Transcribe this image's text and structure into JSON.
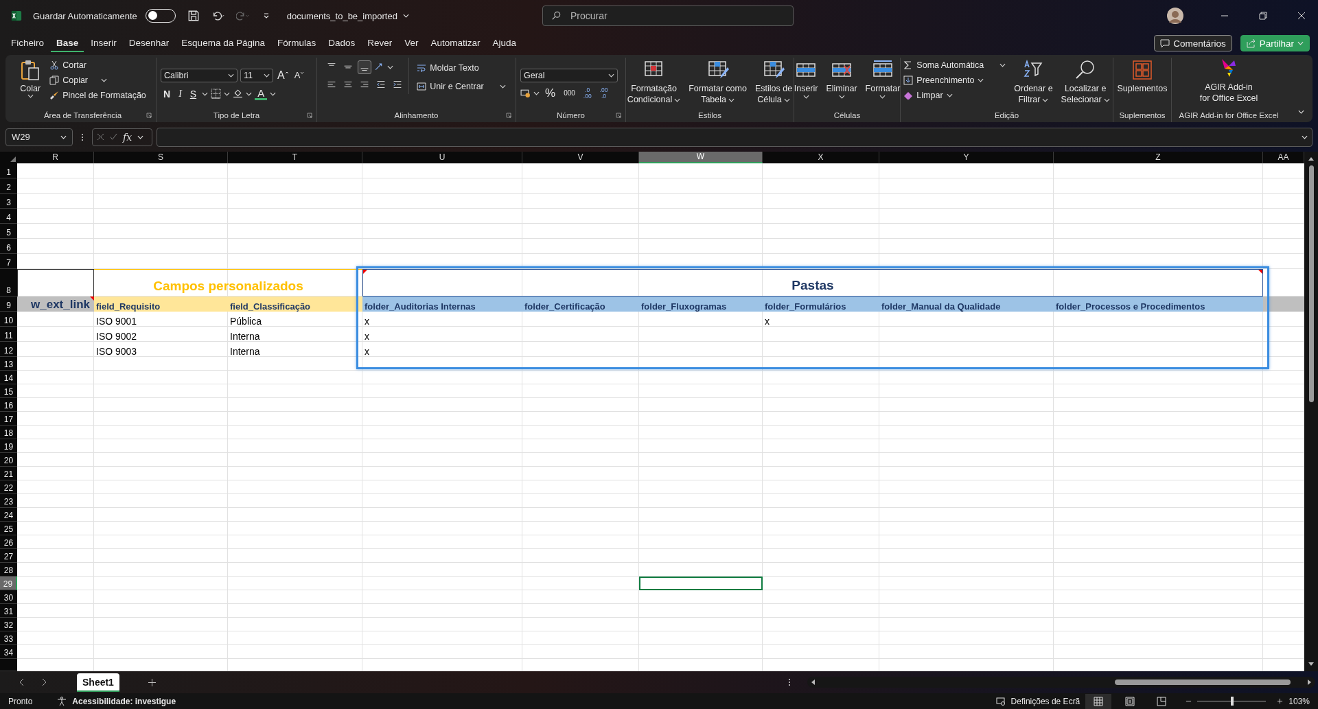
{
  "title_bar": {
    "autosave_label": "Guardar Automaticamente",
    "autosave_on": false,
    "redo_enabled": false,
    "file_name": "documents_to_be_imported",
    "search_placeholder": "Procurar"
  },
  "menu_tabs": [
    {
      "label": "Ficheiro",
      "selected": false
    },
    {
      "label": "Base",
      "selected": true
    },
    {
      "label": "Inserir",
      "selected": false
    },
    {
      "label": "Desenhar",
      "selected": false
    },
    {
      "label": "Esquema da Página",
      "selected": false
    },
    {
      "label": "Fórmulas",
      "selected": false
    },
    {
      "label": "Dados",
      "selected": false
    },
    {
      "label": "Rever",
      "selected": false
    },
    {
      "label": "Ver",
      "selected": false
    },
    {
      "label": "Automatizar",
      "selected": false
    },
    {
      "label": "Ajuda",
      "selected": false
    }
  ],
  "comments_button": "Comentários",
  "share_button": "Partilhar",
  "ribbon": {
    "clipboard": {
      "label": "Área de Transferência",
      "paste": "Colar",
      "cut": "Cortar",
      "copy": "Copiar",
      "format_painter": "Pincel de Formatação"
    },
    "font": {
      "label": "Tipo de Letra",
      "font_name": "Calibri",
      "font_size": "11",
      "grow": "A",
      "shrink": "A",
      "bold": "N",
      "italic": "I",
      "underline": "S",
      "font_color": "A"
    },
    "alignment": {
      "label": "Alinhamento",
      "valign": [
        {
          "selected": false
        },
        {
          "selected": false
        },
        {
          "selected": true
        }
      ],
      "wrap_text": "Moldar Texto",
      "merge_center": "Unir e Centrar"
    },
    "number": {
      "label": "Número",
      "format": "Geral",
      "percent": "%",
      "thousands": "000",
      "increase_decimal": [
        ".0",
        ".00"
      ],
      "decrease_decimal": [
        ".00",
        ".0"
      ]
    },
    "styles": {
      "label": "Estilos",
      "buttons": [
        [
          "Formatação",
          "Condicional"
        ],
        [
          "Formatar como",
          "Tabela"
        ],
        [
          "Estilos de",
          "Célula"
        ]
      ]
    },
    "cells": {
      "label": "Células",
      "buttons": [
        "Inserir",
        "Eliminar",
        "Formatar"
      ]
    },
    "editing": {
      "label": "Edição",
      "autosum": "Soma Automática",
      "fill": "Preenchimento",
      "clear": "Limpar",
      "sort": [
        "Ordenar e",
        "Filtrar"
      ],
      "find": [
        "Localizar e",
        "Selecionar"
      ]
    },
    "addins": {
      "label": "Suplementos",
      "button": "Suplementos"
    },
    "agir": {
      "label": "AGIR Add-in for Office Excel",
      "button": [
        "AGIR Add-in",
        "for Office Excel"
      ]
    }
  },
  "formula_bar": {
    "name_box": "W29",
    "function_label": "fx"
  },
  "columns": [
    {
      "label": "R",
      "selected": false
    },
    {
      "label": "S",
      "selected": false
    },
    {
      "label": "T",
      "selected": false
    },
    {
      "label": "U",
      "selected": false
    },
    {
      "label": "V",
      "selected": false
    },
    {
      "label": "W",
      "selected": true
    },
    {
      "label": "X",
      "selected": false
    },
    {
      "label": "Y",
      "selected": false
    },
    {
      "label": "Z",
      "selected": false
    },
    {
      "label": "AA",
      "selected": false
    }
  ],
  "row_headers": [
    {
      "label": "1",
      "selected": false
    },
    {
      "label": "2",
      "selected": false
    },
    {
      "label": "3",
      "selected": false
    },
    {
      "label": "4",
      "selected": false
    },
    {
      "label": "5",
      "selected": false
    },
    {
      "label": "6",
      "selected": false
    },
    {
      "label": "7",
      "selected": false
    },
    {
      "label": "8",
      "selected": false
    },
    {
      "label": "9",
      "selected": false
    },
    {
      "label": "10",
      "selected": false
    },
    {
      "label": "11",
      "selected": false
    },
    {
      "label": "12",
      "selected": false
    },
    {
      "label": "13",
      "selected": false
    },
    {
      "label": "14",
      "selected": false
    },
    {
      "label": "15",
      "selected": false
    },
    {
      "label": "16",
      "selected": false
    },
    {
      "label": "17",
      "selected": false
    },
    {
      "label": "18",
      "selected": false
    },
    {
      "label": "19",
      "selected": false
    },
    {
      "label": "20",
      "selected": false
    },
    {
      "label": "21",
      "selected": false
    },
    {
      "label": "22",
      "selected": false
    },
    {
      "label": "23",
      "selected": false
    },
    {
      "label": "24",
      "selected": false
    },
    {
      "label": "25",
      "selected": false
    },
    {
      "label": "26",
      "selected": false
    },
    {
      "label": "27",
      "selected": false
    },
    {
      "label": "28",
      "selected": false
    },
    {
      "label": "29",
      "selected": true
    },
    {
      "label": "30",
      "selected": false
    },
    {
      "label": "31",
      "selected": false
    },
    {
      "label": "32",
      "selected": false
    },
    {
      "label": "33",
      "selected": false
    },
    {
      "label": "34",
      "selected": false
    }
  ],
  "sheet": {
    "group_headers": [
      {
        "label": "Campos personalizados",
        "kind": "custom"
      },
      {
        "label": "Pastas",
        "kind": "folders"
      }
    ],
    "partial_header": "w_ext_link",
    "headers": [
      "field_Requisito",
      "field_Classificação",
      "folder_Auditorias Internas",
      "folder_Certificação",
      "folder_Fluxogramas",
      "folder_Formulários",
      "folder_Manual da Qualidade",
      "folder_Processos e Procedimentos"
    ],
    "data_rows": [
      [
        "ISO 9001",
        "Pública",
        "x",
        null,
        null,
        "x",
        null,
        null
      ],
      [
        "ISO 9002",
        "Interna",
        "x",
        null,
        null,
        null,
        null,
        null
      ],
      [
        "ISO 9003",
        "Interna",
        "x",
        null,
        null,
        null,
        null,
        null
      ]
    ]
  },
  "sheet_tabs": [
    {
      "label": "Sheet1",
      "selected": true
    }
  ],
  "status_bar": {
    "ready": "Pronto",
    "accessibility": "Acessibilidade: investigue",
    "display_settings": "Definições de Ecrã",
    "views": [
      {
        "selected": true
      },
      {
        "selected": false
      },
      {
        "selected": false
      }
    ],
    "zoom_slider": {
      "level": 0.51
    },
    "zoom": "103%"
  }
}
